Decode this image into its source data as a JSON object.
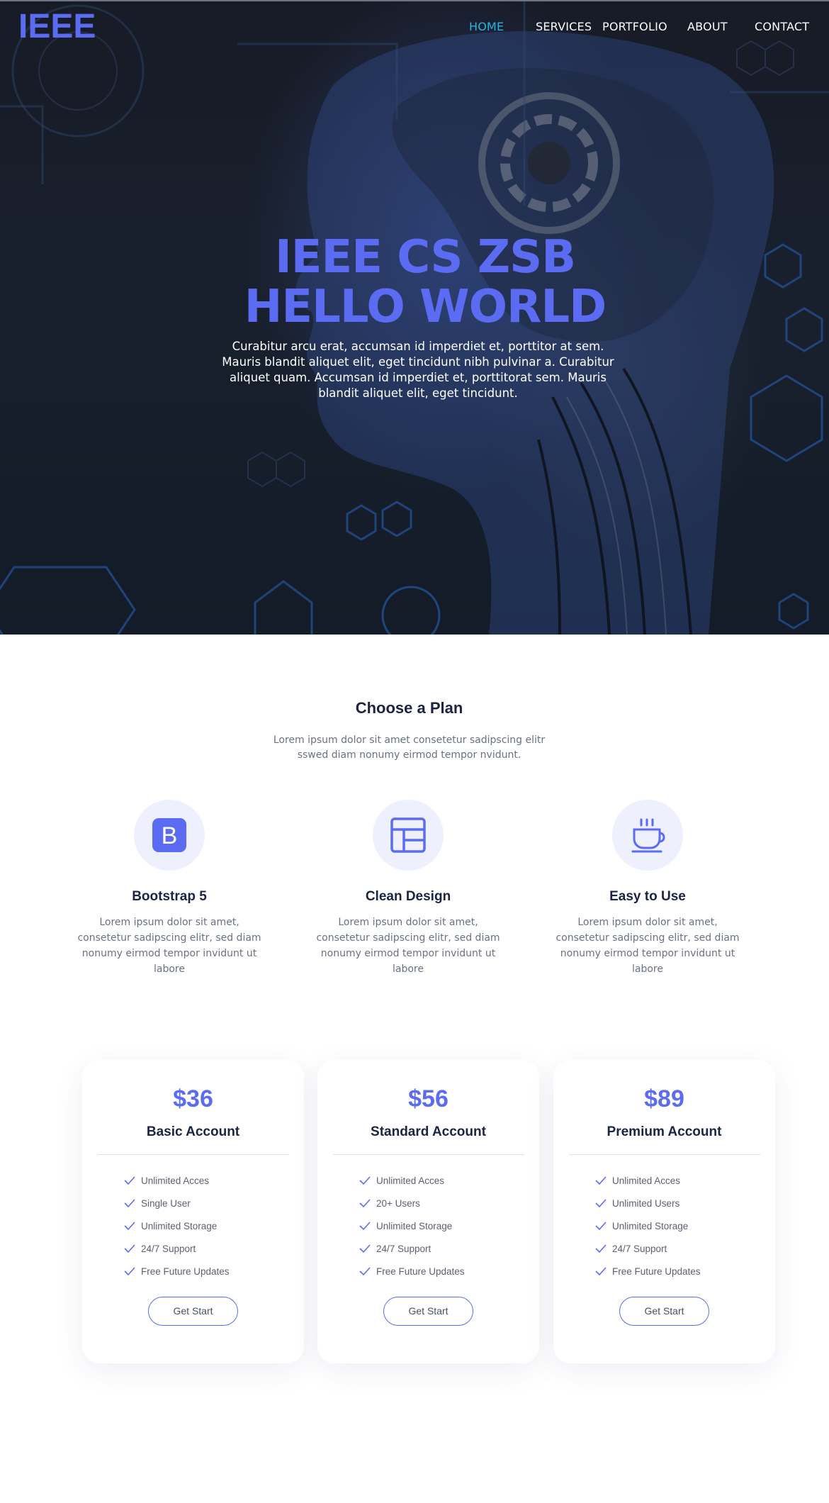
{
  "header": {
    "logo": "IEEE",
    "nav": [
      {
        "label": "HOME",
        "active": true
      },
      {
        "label": "SERVICES",
        "active": false
      },
      {
        "label": "PORTFOLIO",
        "active": false
      },
      {
        "label": "ABOUT",
        "active": false
      },
      {
        "label": "CONTACT",
        "active": false
      }
    ]
  },
  "hero": {
    "title_line1": "IEEE CS ZSB",
    "title_line2": "HELLO WORLD",
    "subtitle": "Curabitur arcu erat, accumsan id imperdiet et, porttitor at sem. Mauris blandit aliquet elit,  eget tincidunt nibh pulvinar a. Curabitur aliquet quam. Accumsan id imperdiet et, porttitorat  sem. Mauris blandit aliquet elit, eget tincidunt."
  },
  "plans_section": {
    "title": "Choose a Plan",
    "subtitle": "Lorem ipsum dolor sit amet consetetur sadipscing elitr sswed diam nonumy eirmod tempor nvidunt."
  },
  "features": [
    {
      "icon": "bootstrap-icon",
      "title": "Bootstrap 5",
      "text": "Lorem ipsum dolor sit amet, consetetur sadipscing elitr, sed diam nonumy eirmod tempor invidunt ut labore"
    },
    {
      "icon": "layout-icon",
      "title": "Clean Design",
      "text": "Lorem ipsum dolor sit amet, consetetur sadipscing elitr, sed diam nonumy eirmod tempor invidunt ut labore"
    },
    {
      "icon": "coffee-cup-icon",
      "title": "Easy to Use",
      "text": "Lorem ipsum dolor sit amet, consetetur sadipscing elitr, sed diam nonumy eirmod tempor invidunt ut labore"
    }
  ],
  "pricing": [
    {
      "price": "$36",
      "name": "Basic Account",
      "features": [
        "Unlimited Acces",
        "Single User",
        "Unlimited Storage",
        "24/7 Support",
        "Free Future Updates"
      ],
      "button": "Get Start"
    },
    {
      "price": "$56",
      "name": "Standard Account",
      "features": [
        "Unlimited Acces",
        "20+ Users",
        "Unlimited Storage",
        "24/7 Support",
        "Free Future Updates"
      ],
      "button": "Get Start"
    },
    {
      "price": "$89",
      "name": "Premium Account",
      "features": [
        "Unlimited Acces",
        "Unlimited Users",
        "Unlimited Storage",
        "24/7 Support",
        "Free Future Updates"
      ],
      "button": "Get Start"
    }
  ],
  "colors": {
    "accent": "#5b6cf2",
    "nav_active": "#25b6e6",
    "heading": "#1c2344",
    "muted_text": "#6b7185",
    "icon_bg": "#eef0fd",
    "hero_bg": "#1d2535"
  }
}
